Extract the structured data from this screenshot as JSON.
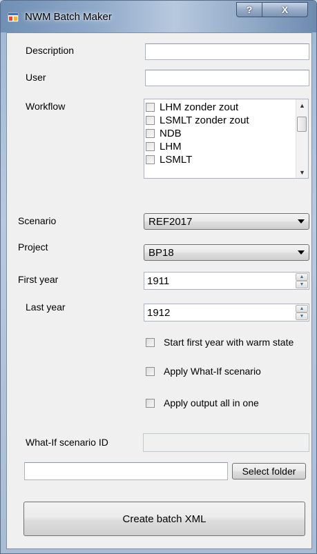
{
  "window": {
    "title": "NWM Batch Maker",
    "help_glyph": "?",
    "close_glyph": "X"
  },
  "form": {
    "description_label": "Description",
    "description_value": "",
    "user_label": "User",
    "user_value": "",
    "workflow_label": "Workflow",
    "workflow_items": [
      "LHM zonder zout",
      "LSMLT zonder zout",
      "NDB",
      "LHM",
      "LSMLT"
    ],
    "scenario_label": "Scenario",
    "scenario_value": "REF2017",
    "project_label": "Project",
    "project_value": "BP18",
    "first_year_label": "First year",
    "first_year_value": "1911",
    "last_year_label": "Last year",
    "last_year_value": "1912",
    "check_warm_state": "Start first year with warm state",
    "check_what_if": "Apply What-If scenario",
    "check_output_all": "Apply output all in one",
    "what_if_id_label": "What-If scenario ID",
    "what_if_id_value": "",
    "folder_value": "",
    "select_folder_label": "Select folder",
    "create_button_label": "Create batch XML"
  },
  "icons": {
    "app": "app-window-icon",
    "up": "arrow-up-icon",
    "down": "arrow-down-icon"
  }
}
